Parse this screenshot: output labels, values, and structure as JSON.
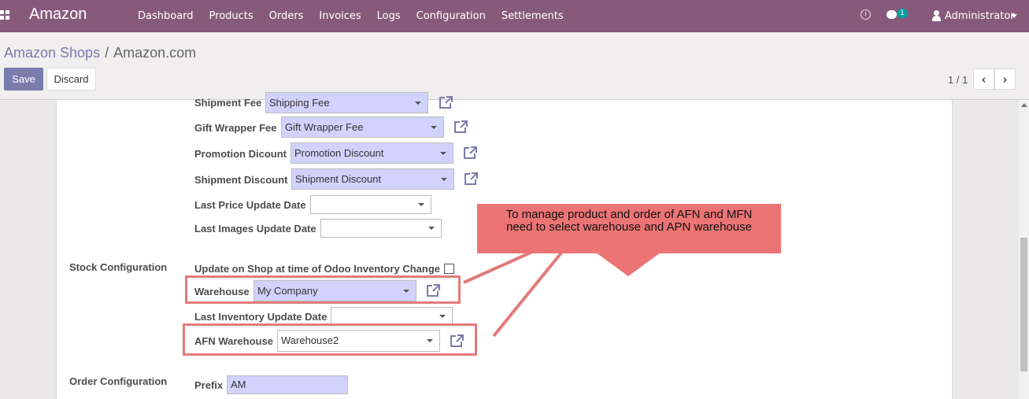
{
  "navbar": {
    "brand": "Amazon",
    "menu": [
      "Dashboard",
      "Products",
      "Orders",
      "Invoices",
      "Logs",
      "Configuration",
      "Settlements"
    ],
    "chat_count": "1",
    "user": "Administrator",
    "bg_color": "#875a7b"
  },
  "breadcrumb": {
    "parent": "Amazon Shops",
    "separator": "/",
    "current": "Amazon.com"
  },
  "buttons": {
    "save": "Save",
    "discard": "Discard"
  },
  "pager": {
    "value": "1 / 1"
  },
  "fields": {
    "shipment_fee": {
      "label": "Shipment Fee",
      "value": "Shipping Fee"
    },
    "gift_wrapper_fee": {
      "label": "Gift Wrapper Fee",
      "value": "Gift Wrapper Fee"
    },
    "promotion_discount": {
      "label": "Promotion Dicount",
      "value": "Promotion Discount"
    },
    "shipment_discount": {
      "label": "Shipment Discount",
      "value": "Shipment Discount"
    },
    "last_price_update": {
      "label": "Last Price Update Date",
      "value": ""
    },
    "last_images_update": {
      "label": "Last Images Update Date",
      "value": ""
    }
  },
  "stock": {
    "section": "Stock Configuration",
    "update_on_shop": {
      "label": "Update on Shop at time of Odoo Inventory Change",
      "checked": false
    },
    "warehouse": {
      "label": "Warehouse",
      "value": "My Company"
    },
    "last_inventory_update": {
      "label": "Last Inventory Update Date",
      "value": ""
    },
    "afn_warehouse": {
      "label": "AFN Warehouse",
      "value": "Warehouse2"
    }
  },
  "order": {
    "section": "Order Configuration",
    "prefix": {
      "label": "Prefix",
      "value": "AM"
    }
  },
  "annotation": {
    "line1": "To manage product and order of AFN and MFN",
    "line2": "need to select warehouse and APN warehouse",
    "color": "#ec7474"
  }
}
